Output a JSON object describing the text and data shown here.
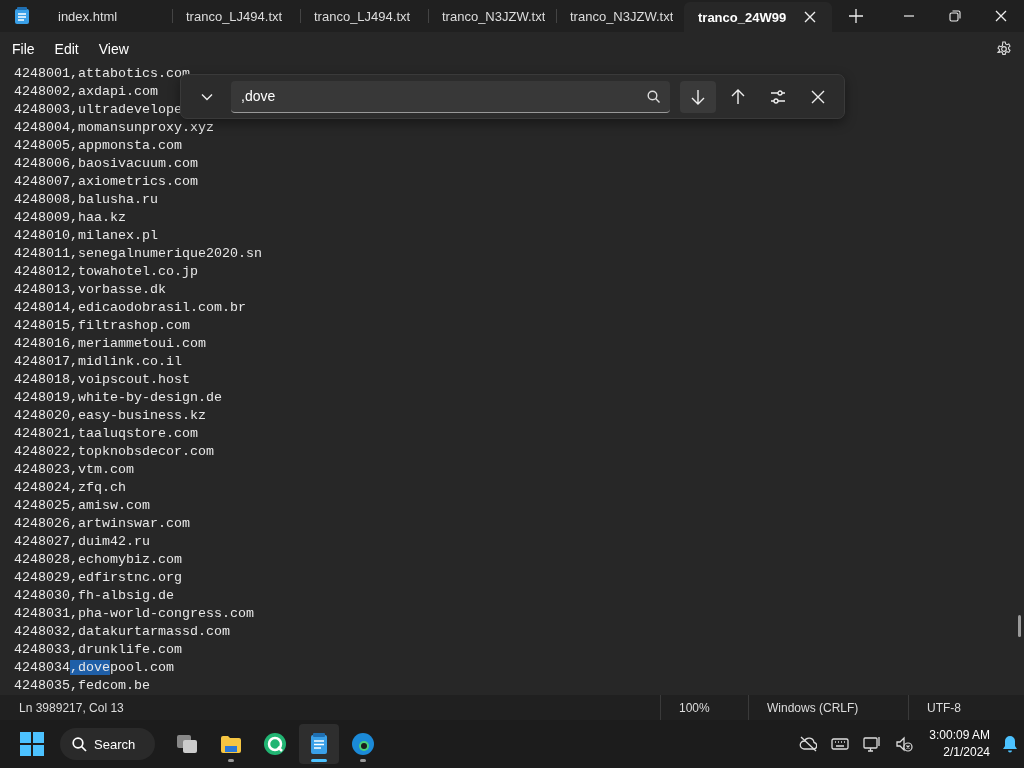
{
  "tabs": [
    {
      "label": "index.html",
      "selected": false
    },
    {
      "label": "tranco_LJ494.txt",
      "selected": false
    },
    {
      "label": "tranco_LJ494.txt",
      "selected": false
    },
    {
      "label": "tranco_N3JZW.txt",
      "selected": false
    },
    {
      "label": "tranco_N3JZW.txt",
      "selected": false
    },
    {
      "label": "tranco_24W99",
      "selected": true
    }
  ],
  "menu": [
    "File",
    "Edit",
    "View"
  ],
  "find": {
    "value": ",dove"
  },
  "lines": [
    {
      "kind": "plain",
      "text": "4248001,attabotics.com"
    },
    {
      "kind": "plain",
      "text": "4248002,axdapi.com"
    },
    {
      "kind": "plain",
      "text": "4248003,ultradevelope"
    },
    {
      "kind": "plain",
      "text": "4248004,momansunproxy.xyz"
    },
    {
      "kind": "plain",
      "text": "4248005,appmonsta.com"
    },
    {
      "kind": "plain",
      "text": "4248006,baosivacuum.com"
    },
    {
      "kind": "plain",
      "text": "4248007,axiometrics.com"
    },
    {
      "kind": "plain",
      "text": "4248008,balusha.ru"
    },
    {
      "kind": "plain",
      "text": "4248009,haa.kz"
    },
    {
      "kind": "plain",
      "text": "4248010,milanex.pl"
    },
    {
      "kind": "plain",
      "text": "4248011,senegalnumerique2020.sn"
    },
    {
      "kind": "plain",
      "text": "4248012,towahotel.co.jp"
    },
    {
      "kind": "plain",
      "text": "4248013,vorbasse.dk"
    },
    {
      "kind": "plain",
      "text": "4248014,edicaodobrasil.com.br"
    },
    {
      "kind": "plain",
      "text": "4248015,filtrashop.com"
    },
    {
      "kind": "plain",
      "text": "4248016,meriammetoui.com"
    },
    {
      "kind": "plain",
      "text": "4248017,midlink.co.il"
    },
    {
      "kind": "plain",
      "text": "4248018,voipscout.host"
    },
    {
      "kind": "plain",
      "text": "4248019,white-by-design.de"
    },
    {
      "kind": "plain",
      "text": "4248020,easy-business.kz"
    },
    {
      "kind": "plain",
      "text": "4248021,taaluqstore.com"
    },
    {
      "kind": "plain",
      "text": "4248022,topknobsdecor.com"
    },
    {
      "kind": "plain",
      "text": "4248023,vtm.com"
    },
    {
      "kind": "plain",
      "text": "4248024,zfq.ch"
    },
    {
      "kind": "plain",
      "text": "4248025,amisw.com"
    },
    {
      "kind": "plain",
      "text": "4248026,artwinswar.com"
    },
    {
      "kind": "plain",
      "text": "4248027,duim42.ru"
    },
    {
      "kind": "plain",
      "text": "4248028,echomybiz.com"
    },
    {
      "kind": "plain",
      "text": "4248029,edfirstnc.org"
    },
    {
      "kind": "plain",
      "text": "4248030,fh-albsig.de"
    },
    {
      "kind": "plain",
      "text": "4248031,pha-world-congress.com"
    },
    {
      "kind": "plain",
      "text": "4248032,datakurtarmassd.com"
    },
    {
      "kind": "plain",
      "text": "4248033,drunklife.com"
    },
    {
      "kind": "match",
      "before": "4248034",
      "match": ",dove",
      "after": "pool.com"
    },
    {
      "kind": "plain",
      "text": "4248035,fedcom.be"
    }
  ],
  "status_bar": {
    "position": "Ln 3989217, Col 13",
    "zoom": "100%",
    "line_ending": "Windows (CRLF)",
    "encoding": "UTF-8"
  },
  "taskbar": {
    "search": "Search",
    "apps": [
      {
        "kind": "taskview",
        "selected": false,
        "running": false
      },
      {
        "kind": "folder",
        "selected": false,
        "running": true
      },
      {
        "kind": "green",
        "selected": false,
        "running": false
      },
      {
        "kind": "notepad",
        "selected": true,
        "running": true
      },
      {
        "kind": "edge",
        "selected": false,
        "running": true
      }
    ],
    "time": "3:00:09 AM",
    "date": "2/1/2024"
  }
}
